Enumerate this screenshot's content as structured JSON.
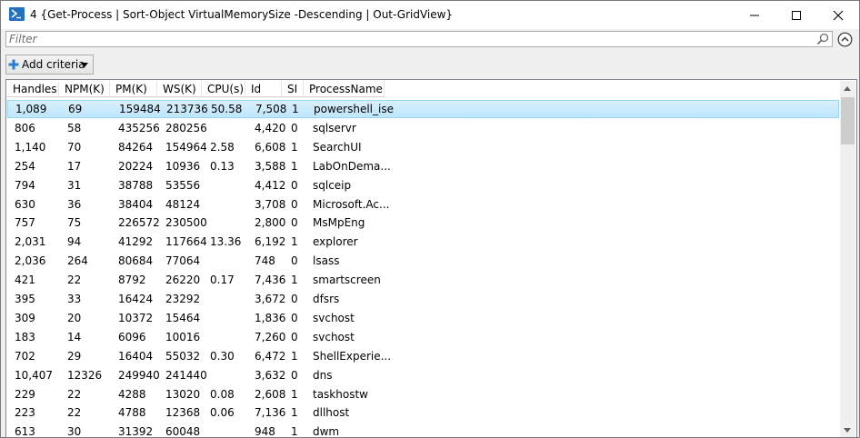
{
  "window": {
    "title": "4 {Get-Process | Sort-Object VirtualMemorySize -Descending | Out-GridView}",
    "icon": "powershell-icon"
  },
  "filter": {
    "placeholder": "Filter"
  },
  "toolbar": {
    "add_criteria_label": "Add criteria"
  },
  "grid": {
    "columns": [
      "Handles",
      "NPM(K)",
      "PM(K)",
      "WS(K)",
      "CPU(s)",
      "Id",
      "SI",
      "ProcessName"
    ],
    "selected_row": 0,
    "rows": [
      [
        "1,089",
        "69",
        "159484",
        "213736",
        "50.58",
        "7,508",
        "1",
        "powershell_ise"
      ],
      [
        "806",
        "58",
        "435256",
        "280256",
        "",
        "4,420",
        "0",
        "sqlservr"
      ],
      [
        "1,140",
        "70",
        "84264",
        "154964",
        "2.58",
        "6,608",
        "1",
        "SearchUI"
      ],
      [
        "254",
        "17",
        "20224",
        "10936",
        "0.13",
        "3,588",
        "1",
        "LabOnDema..."
      ],
      [
        "794",
        "31",
        "38788",
        "53556",
        "",
        "4,412",
        "0",
        "sqlceip"
      ],
      [
        "630",
        "36",
        "38404",
        "48124",
        "",
        "3,708",
        "0",
        "Microsoft.Ac..."
      ],
      [
        "757",
        "75",
        "226572",
        "230500",
        "",
        "2,800",
        "0",
        "MsMpEng"
      ],
      [
        "2,031",
        "94",
        "41292",
        "117664",
        "13.36",
        "6,192",
        "1",
        "explorer"
      ],
      [
        "2,036",
        "264",
        "80684",
        "77064",
        "",
        "748",
        "0",
        "lsass"
      ],
      [
        "421",
        "22",
        "8792",
        "26220",
        "0.17",
        "7,436",
        "1",
        "smartscreen"
      ],
      [
        "395",
        "33",
        "16424",
        "23292",
        "",
        "3,672",
        "0",
        "dfsrs"
      ],
      [
        "309",
        "20",
        "10372",
        "15464",
        "",
        "1,836",
        "0",
        "svchost"
      ],
      [
        "183",
        "14",
        "6096",
        "10016",
        "",
        "7,260",
        "0",
        "svchost"
      ],
      [
        "702",
        "29",
        "16404",
        "55032",
        "0.30",
        "6,472",
        "1",
        "ShellExperie..."
      ],
      [
        "10,407",
        "12326",
        "249940",
        "241440",
        "",
        "3,632",
        "0",
        "dns"
      ],
      [
        "229",
        "22",
        "4288",
        "13020",
        "0.08",
        "2,608",
        "1",
        "taskhostw"
      ],
      [
        "223",
        "22",
        "4788",
        "12368",
        "0.06",
        "7,136",
        "1",
        "dllhost"
      ],
      [
        "613",
        "30",
        "31392",
        "60048",
        "",
        "948",
        "1",
        "dwm"
      ]
    ]
  },
  "colors": {
    "selection": "#bee6fd",
    "selection_border": "#9ad6f7",
    "powershell_blue": "#2671be"
  }
}
